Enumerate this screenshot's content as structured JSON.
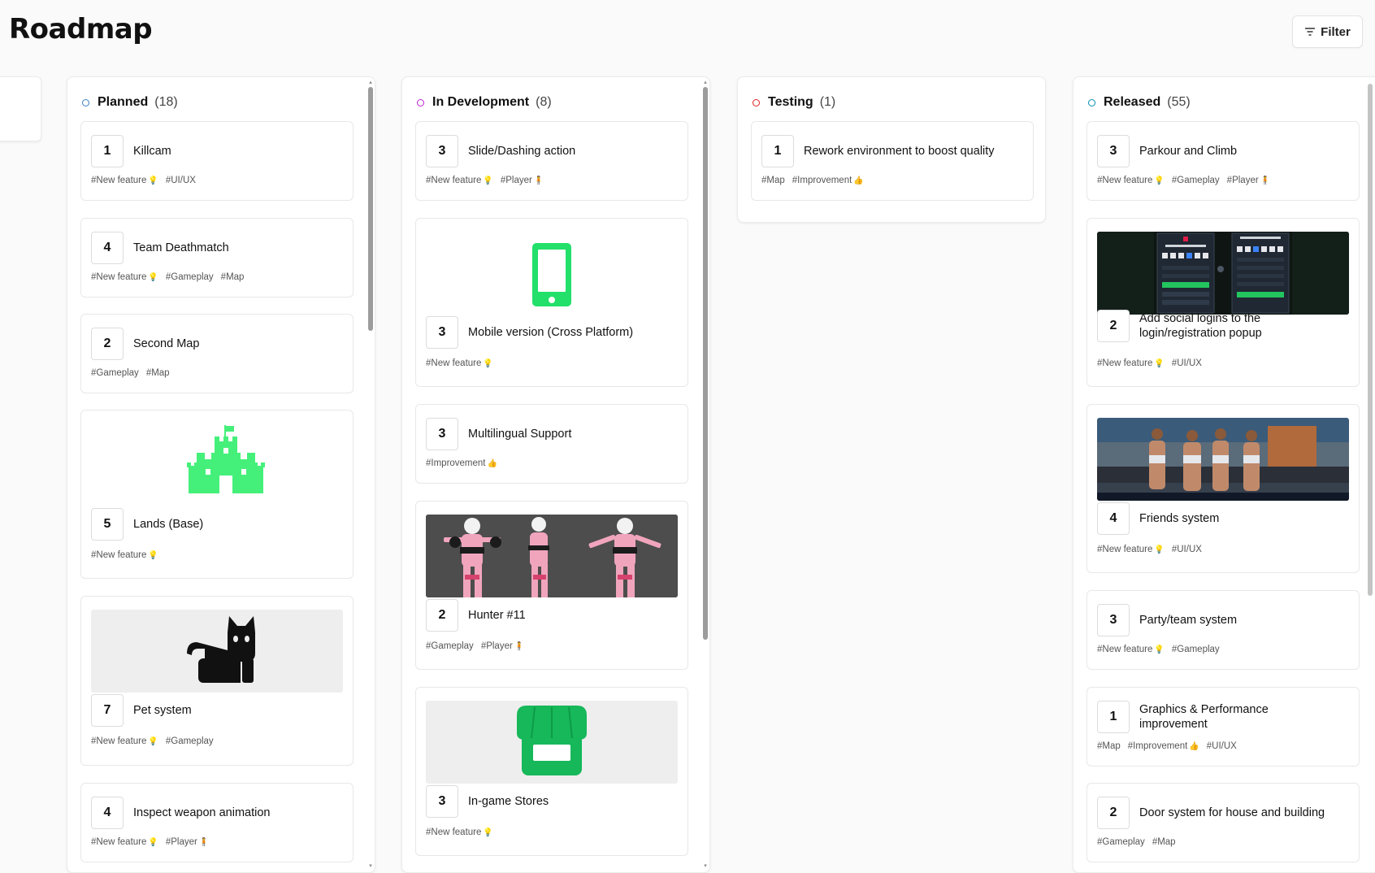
{
  "page": {
    "title": "Roadmap"
  },
  "toolbar": {
    "filter_label": "Filter"
  },
  "columns": [
    {
      "name": "Planned",
      "count": "(18)",
      "dot_color": "#3b82c4",
      "cards": [
        {
          "votes": "1",
          "title": "Killcam",
          "tags": [
            "#New feature",
            "#UI/UX"
          ]
        },
        {
          "votes": "4",
          "title": "Team Deathmatch",
          "tags": [
            "#New feature",
            "#Gameplay",
            "#Map"
          ]
        },
        {
          "votes": "2",
          "title": "Second Map",
          "tags": [
            "#Gameplay",
            "#Map"
          ]
        },
        {
          "votes": "5",
          "title": "Lands (Base)",
          "tags": [
            "#New feature"
          ],
          "media": "castle-icon"
        },
        {
          "votes": "7",
          "title": "Pet system",
          "tags": [
            "#New feature",
            "#Gameplay"
          ],
          "media": "cat-icon"
        },
        {
          "votes": "4",
          "title": "Inspect weapon animation",
          "tags": [
            "#New feature",
            "#Player"
          ]
        }
      ]
    },
    {
      "name": "In Development",
      "count": "(8)",
      "dot_color": "#c026d3",
      "cards": [
        {
          "votes": "3",
          "title": "Slide/Dashing action",
          "tags": [
            "#New feature",
            "#Player"
          ]
        },
        {
          "votes": "3",
          "title": "Mobile version (Cross Platform)",
          "tags": [
            "#New feature"
          ],
          "media": "mobile-phone-icon"
        },
        {
          "votes": "3",
          "title": "Multilingual Support",
          "tags": [
            "#Improvement"
          ]
        },
        {
          "votes": "2",
          "title": "Hunter #11",
          "tags": [
            "#Gameplay",
            "#Player"
          ],
          "media": "character-render-image"
        },
        {
          "votes": "3",
          "title": "In-game Stores",
          "tags": [
            "#New feature"
          ],
          "media": "store-icon"
        }
      ]
    },
    {
      "name": "Testing",
      "count": "(1)",
      "dot_color": "#dc2626",
      "cards": [
        {
          "votes": "1",
          "title": "Rework environment to boost quality",
          "tags": [
            "#Map",
            "#Improvement"
          ]
        }
      ]
    },
    {
      "name": "Released",
      "count": "(55)",
      "dot_color": "#0891b2",
      "cards": [
        {
          "votes": "3",
          "title": "Parkour and Climb",
          "tags": [
            "#New feature",
            "#Gameplay",
            "#Player"
          ]
        },
        {
          "votes": "2",
          "title": "Add social logins to the login/registration popup",
          "tags": [
            "#New feature",
            "#UI/UX"
          ],
          "media": "login-popup-screenshot"
        },
        {
          "votes": "4",
          "title": "Friends system",
          "tags": [
            "#New feature",
            "#UI/UX"
          ],
          "media": "friends-lobby-screenshot"
        },
        {
          "votes": "3",
          "title": "Party/team system",
          "tags": [
            "#New feature",
            "#Gameplay"
          ]
        },
        {
          "votes": "1",
          "title": "Graphics & Performance improvement",
          "tags": [
            "#Map",
            "#Improvement",
            "#UI/UX"
          ]
        },
        {
          "votes": "2",
          "title": "Door system for house and building",
          "tags": [
            "#Gameplay",
            "#Map"
          ]
        }
      ]
    }
  ],
  "tag_emojis": {
    "#New feature": "💡",
    "#Player": "🧍",
    "#Improvement": "👍"
  },
  "colors": {
    "accent_green": "#22e06a",
    "store_green": "#16a34a",
    "background": "#fafafa"
  }
}
